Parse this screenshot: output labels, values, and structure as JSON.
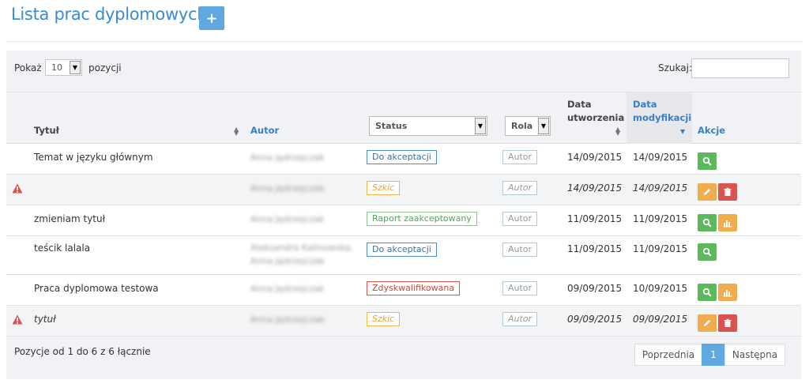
{
  "header": {
    "title": "Lista prac dyplomowych",
    "add_icon": "+"
  },
  "toolbar": {
    "show_label": "Pokaż",
    "length_value": "10",
    "entries_label": "pozycji",
    "search_label": "Szukaj:",
    "search_value": ""
  },
  "columns": {
    "title": "Tytuł",
    "author": "Autor",
    "status_filter": "Status",
    "role_filter": "Rola",
    "created_1": "Data",
    "created_2": "utworzenia",
    "modified_1": "Data",
    "modified_2": "modyfikacji",
    "actions": "Akcje"
  },
  "rows": [
    {
      "warning": false,
      "title": "Temat w języku głównym",
      "author1": "Anna Jędrzejczak",
      "author2": "",
      "status": "Do akceptacji",
      "status_color": "blue",
      "role": "Autor",
      "created": "14/09/2015",
      "modified": "14/09/2015",
      "italic": false,
      "actions": [
        "search-icon"
      ]
    },
    {
      "warning": true,
      "title": "",
      "author1": "Anna Jędrzejczak",
      "author2": "",
      "status": "Szkic",
      "status_color": "orange",
      "role": "Autor",
      "created": "14/09/2015",
      "modified": "14/09/2015",
      "italic": true,
      "actions": [
        "pencil-icon",
        "trash-icon"
      ]
    },
    {
      "warning": false,
      "title": "zmieniam tytuł",
      "author1": "Anna Jędrzejczak",
      "author2": "",
      "status": "Raport zaakceptowany",
      "status_color": "green",
      "role": "Autor",
      "created": "11/09/2015",
      "modified": "11/09/2015",
      "italic": false,
      "actions": [
        "search-icon",
        "chart-icon"
      ]
    },
    {
      "warning": false,
      "title": "teścik lalala",
      "author1": "Aleksandra Kalinowska,",
      "author2": "Anna Jędrzejczak",
      "status": "Do akceptacji",
      "status_color": "blue",
      "role": "Autor",
      "created": "11/09/2015",
      "modified": "11/09/2015",
      "italic": false,
      "actions": [
        "search-icon"
      ]
    },
    {
      "warning": false,
      "title": "Praca dyplomowa testowa",
      "author1": "Anna Jędrzejczak",
      "author2": "",
      "status": "Zdyskwalifikowana",
      "status_color": "red",
      "role": "Autor",
      "created": "09/09/2015",
      "modified": "10/09/2015",
      "italic": false,
      "actions": [
        "search-icon",
        "chart-icon"
      ]
    },
    {
      "warning": true,
      "title": "tytuł",
      "author1": "Anna Jędrzejczak",
      "author2": "",
      "status": "Szkic",
      "status_color": "orange",
      "role": "Autor",
      "created": "09/09/2015",
      "modified": "09/09/2015",
      "italic": true,
      "actions": [
        "pencil-icon",
        "trash-icon"
      ]
    }
  ],
  "footer": {
    "info": "Pozycje od 1 do 6 z 6 łącznie",
    "prev": "Poprzednia",
    "page": "1",
    "next": "Następna"
  }
}
